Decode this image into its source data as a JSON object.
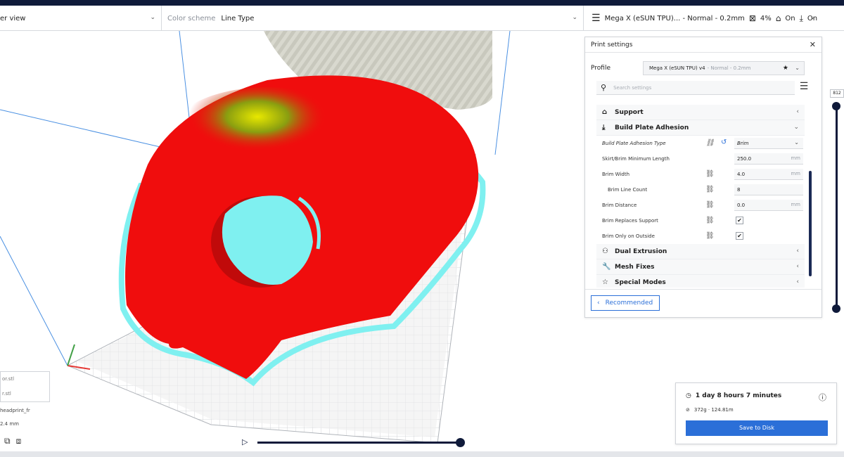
{
  "topbar": {
    "view_label": "er view",
    "scheme_label": "Color scheme",
    "scheme_value": "Line Type",
    "printer_label": "Mega X (eSUN TPU)... - Normal - 0.2mm",
    "infill_value": "4%",
    "support_value": "On",
    "adhesion_value": "On"
  },
  "panel": {
    "title": "Print settings",
    "profile_label": "Profile",
    "profile_name": "Mega X (eSUN TPU) v4",
    "profile_quality": "- Normal - 0.2mm",
    "search_placeholder": "Search settings",
    "categories": {
      "support": "Support",
      "adhesion": "Build Plate Adhesion",
      "dual": "Dual Extrusion",
      "mesh": "Mesh Fixes",
      "special": "Special Modes"
    },
    "settings": [
      {
        "label": "Build Plate Adhesion Type",
        "value": "Brim",
        "unit": ""
      },
      {
        "label": "Skirt/Brim Minimum Length",
        "value": "250.0",
        "unit": "mm"
      },
      {
        "label": "Brim Width",
        "value": "4.0",
        "unit": "mm"
      },
      {
        "label": "Brim Line Count",
        "value": "8",
        "unit": ""
      },
      {
        "label": "Brim Distance",
        "value": "0.0",
        "unit": "mm"
      },
      {
        "label": "Brim Replaces Support",
        "value": "✔",
        "unit": ""
      },
      {
        "label": "Brim Only on Outside",
        "value": "✔",
        "unit": ""
      }
    ],
    "recommended_label": "Recommended"
  },
  "layer_slider": {
    "max_layer": "812"
  },
  "objects": {
    "items": [
      "or.stl",
      "r.stl"
    ],
    "name": "headprint_fr",
    "dims": "2.4 mm"
  },
  "estimate": {
    "time": "1 day 8 hours 7 minutes",
    "material": "372g · 124.81m",
    "save_label": "Save to Disk"
  },
  "colors": {
    "accent": "#2b6fd8",
    "navy": "#0f1a3a",
    "model_red": "#f00d0d",
    "brim_cyan": "#7ff0f0",
    "top_yellow": "#e8e800"
  },
  "icons": {
    "settings": "sliders-icon",
    "infill": "infill-icon",
    "support": "support-icon",
    "adhesion": "adhesion-icon"
  }
}
